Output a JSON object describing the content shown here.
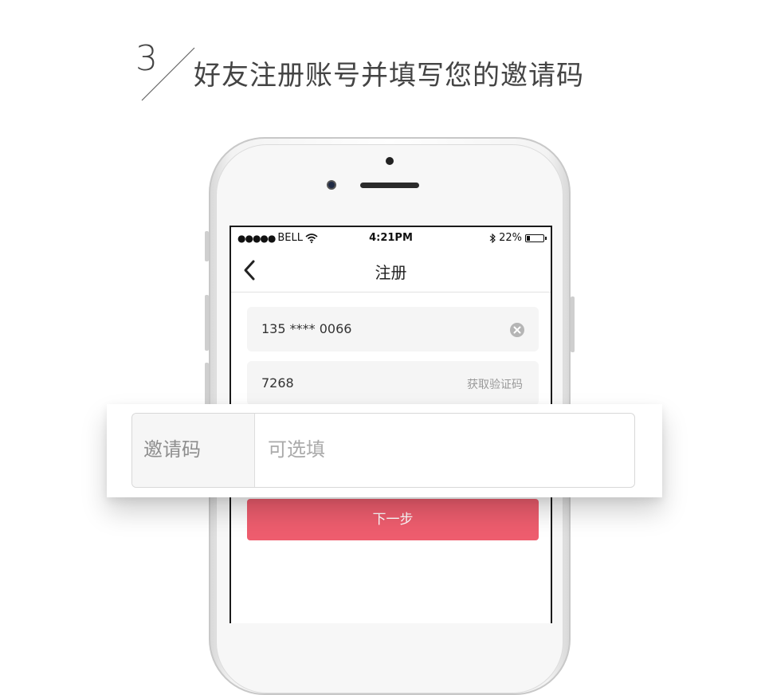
{
  "heading": {
    "step_number": "3",
    "title": "好友注册账号并填写您的邀请码"
  },
  "status_bar": {
    "carrier": "BELL",
    "time": "4:21PM",
    "battery_percent": "22%",
    "battery_level": 0.22
  },
  "nav": {
    "title": "注册"
  },
  "form": {
    "phone_value": "135 **** 0066",
    "code_value": "7268",
    "get_code_label": "获取验证码",
    "invite_label": "邀请码",
    "invite_placeholder": "可选填",
    "next_label": "下一步"
  },
  "colors": {
    "accent": "#ee5d6e"
  }
}
